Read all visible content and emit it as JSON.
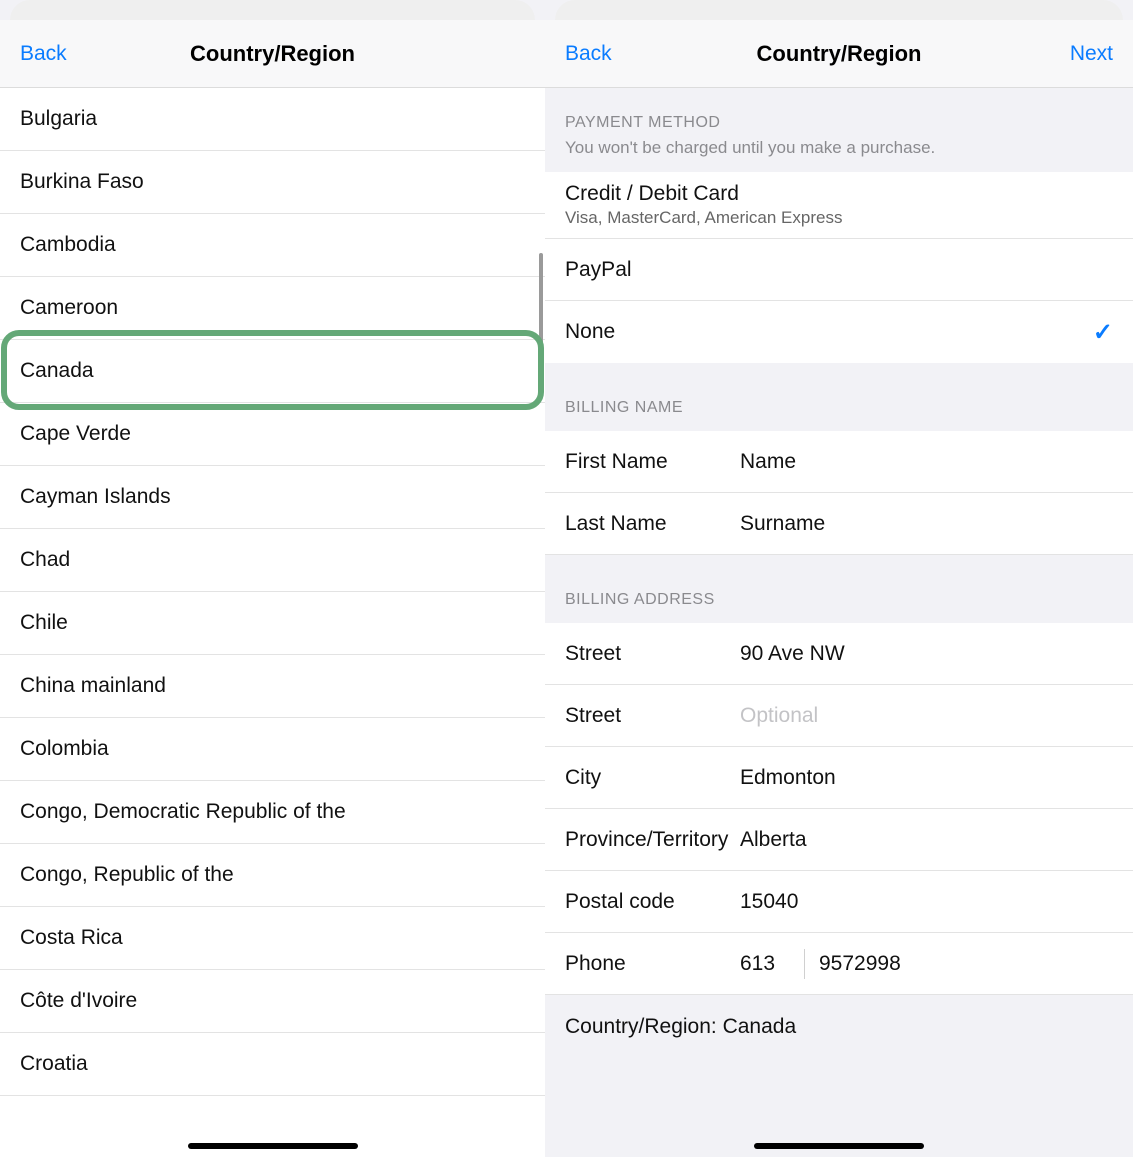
{
  "left": {
    "nav": {
      "back": "Back",
      "title": "Country/Region"
    },
    "countries": [
      "Bulgaria",
      "Burkina Faso",
      "Cambodia",
      "Cameroon",
      "Canada",
      "Cape Verde",
      "Cayman Islands",
      "Chad",
      "Chile",
      "China mainland",
      "Colombia",
      "Congo, Democratic Republic of the",
      "Congo, Republic of the",
      "Costa Rica",
      "Côte d'Ivoire",
      "Croatia"
    ],
    "highlighted": "Canada"
  },
  "right": {
    "nav": {
      "back": "Back",
      "title": "Country/Region",
      "next": "Next"
    },
    "payment": {
      "header": "PAYMENT METHOD",
      "note": "You won't be charged until you make a purchase.",
      "options": [
        {
          "label": "Credit / Debit Card",
          "sub": "Visa, MasterCard, American Express",
          "selected": false
        },
        {
          "label": "PayPal",
          "sub": "",
          "selected": false
        },
        {
          "label": "None",
          "sub": "",
          "selected": true
        }
      ]
    },
    "billing_name": {
      "header": "BILLING NAME",
      "first_label": "First Name",
      "first_value": "Name",
      "last_label": "Last Name",
      "last_value": "Surname"
    },
    "billing_address": {
      "header": "BILLING ADDRESS",
      "street1_label": "Street",
      "street1_value": "90 Ave NW",
      "street2_label": "Street",
      "street2_placeholder": "Optional",
      "city_label": "City",
      "city_value": "Edmonton",
      "province_label": "Province/Territory",
      "province_value": "Alberta",
      "postal_label": "Postal code",
      "postal_value": "15040",
      "phone_label": "Phone",
      "phone_cc": "613",
      "phone_number": "9572998"
    },
    "footer": "Country/Region: Canada"
  }
}
